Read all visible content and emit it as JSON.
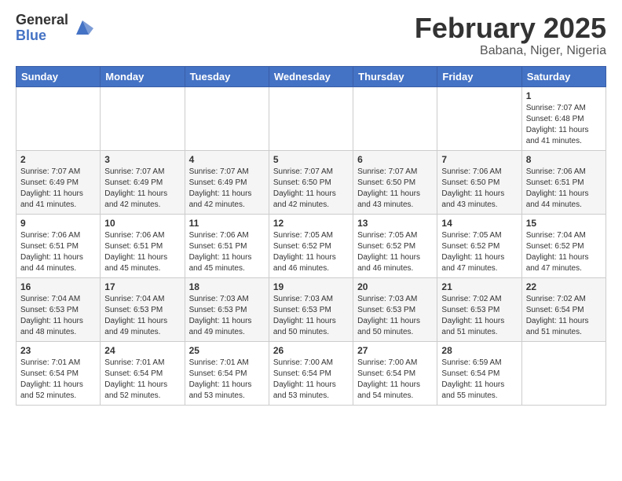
{
  "header": {
    "logo_general": "General",
    "logo_blue": "Blue",
    "main_title": "February 2025",
    "subtitle": "Babana, Niger, Nigeria"
  },
  "weekdays": [
    "Sunday",
    "Monday",
    "Tuesday",
    "Wednesday",
    "Thursday",
    "Friday",
    "Saturday"
  ],
  "weeks": [
    [
      {
        "day": "",
        "info": ""
      },
      {
        "day": "",
        "info": ""
      },
      {
        "day": "",
        "info": ""
      },
      {
        "day": "",
        "info": ""
      },
      {
        "day": "",
        "info": ""
      },
      {
        "day": "",
        "info": ""
      },
      {
        "day": "1",
        "info": "Sunrise: 7:07 AM\nSunset: 6:48 PM\nDaylight: 11 hours\nand 41 minutes."
      }
    ],
    [
      {
        "day": "2",
        "info": "Sunrise: 7:07 AM\nSunset: 6:49 PM\nDaylight: 11 hours\nand 41 minutes."
      },
      {
        "day": "3",
        "info": "Sunrise: 7:07 AM\nSunset: 6:49 PM\nDaylight: 11 hours\nand 42 minutes."
      },
      {
        "day": "4",
        "info": "Sunrise: 7:07 AM\nSunset: 6:49 PM\nDaylight: 11 hours\nand 42 minutes."
      },
      {
        "day": "5",
        "info": "Sunrise: 7:07 AM\nSunset: 6:50 PM\nDaylight: 11 hours\nand 42 minutes."
      },
      {
        "day": "6",
        "info": "Sunrise: 7:07 AM\nSunset: 6:50 PM\nDaylight: 11 hours\nand 43 minutes."
      },
      {
        "day": "7",
        "info": "Sunrise: 7:06 AM\nSunset: 6:50 PM\nDaylight: 11 hours\nand 43 minutes."
      },
      {
        "day": "8",
        "info": "Sunrise: 7:06 AM\nSunset: 6:51 PM\nDaylight: 11 hours\nand 44 minutes."
      }
    ],
    [
      {
        "day": "9",
        "info": "Sunrise: 7:06 AM\nSunset: 6:51 PM\nDaylight: 11 hours\nand 44 minutes."
      },
      {
        "day": "10",
        "info": "Sunrise: 7:06 AM\nSunset: 6:51 PM\nDaylight: 11 hours\nand 45 minutes."
      },
      {
        "day": "11",
        "info": "Sunrise: 7:06 AM\nSunset: 6:51 PM\nDaylight: 11 hours\nand 45 minutes."
      },
      {
        "day": "12",
        "info": "Sunrise: 7:05 AM\nSunset: 6:52 PM\nDaylight: 11 hours\nand 46 minutes."
      },
      {
        "day": "13",
        "info": "Sunrise: 7:05 AM\nSunset: 6:52 PM\nDaylight: 11 hours\nand 46 minutes."
      },
      {
        "day": "14",
        "info": "Sunrise: 7:05 AM\nSunset: 6:52 PM\nDaylight: 11 hours\nand 47 minutes."
      },
      {
        "day": "15",
        "info": "Sunrise: 7:04 AM\nSunset: 6:52 PM\nDaylight: 11 hours\nand 47 minutes."
      }
    ],
    [
      {
        "day": "16",
        "info": "Sunrise: 7:04 AM\nSunset: 6:53 PM\nDaylight: 11 hours\nand 48 minutes."
      },
      {
        "day": "17",
        "info": "Sunrise: 7:04 AM\nSunset: 6:53 PM\nDaylight: 11 hours\nand 49 minutes."
      },
      {
        "day": "18",
        "info": "Sunrise: 7:03 AM\nSunset: 6:53 PM\nDaylight: 11 hours\nand 49 minutes."
      },
      {
        "day": "19",
        "info": "Sunrise: 7:03 AM\nSunset: 6:53 PM\nDaylight: 11 hours\nand 50 minutes."
      },
      {
        "day": "20",
        "info": "Sunrise: 7:03 AM\nSunset: 6:53 PM\nDaylight: 11 hours\nand 50 minutes."
      },
      {
        "day": "21",
        "info": "Sunrise: 7:02 AM\nSunset: 6:53 PM\nDaylight: 11 hours\nand 51 minutes."
      },
      {
        "day": "22",
        "info": "Sunrise: 7:02 AM\nSunset: 6:54 PM\nDaylight: 11 hours\nand 51 minutes."
      }
    ],
    [
      {
        "day": "23",
        "info": "Sunrise: 7:01 AM\nSunset: 6:54 PM\nDaylight: 11 hours\nand 52 minutes."
      },
      {
        "day": "24",
        "info": "Sunrise: 7:01 AM\nSunset: 6:54 PM\nDaylight: 11 hours\nand 52 minutes."
      },
      {
        "day": "25",
        "info": "Sunrise: 7:01 AM\nSunset: 6:54 PM\nDaylight: 11 hours\nand 53 minutes."
      },
      {
        "day": "26",
        "info": "Sunrise: 7:00 AM\nSunset: 6:54 PM\nDaylight: 11 hours\nand 53 minutes."
      },
      {
        "day": "27",
        "info": "Sunrise: 7:00 AM\nSunset: 6:54 PM\nDaylight: 11 hours\nand 54 minutes."
      },
      {
        "day": "28",
        "info": "Sunrise: 6:59 AM\nSunset: 6:54 PM\nDaylight: 11 hours\nand 55 minutes."
      },
      {
        "day": "",
        "info": ""
      }
    ]
  ]
}
